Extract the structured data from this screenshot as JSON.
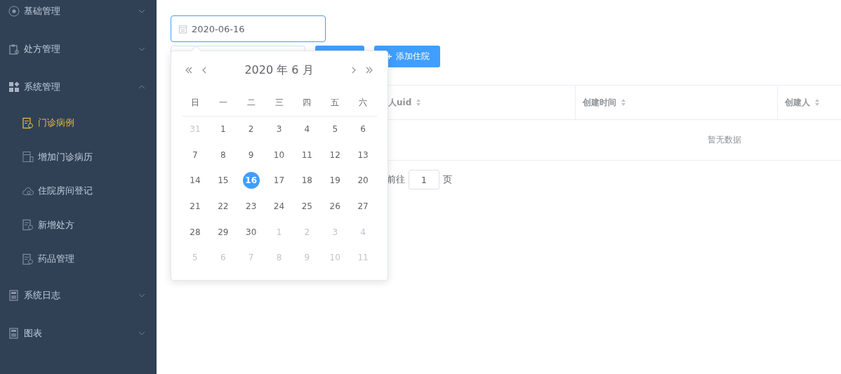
{
  "sidebar": {
    "items": [
      {
        "label": "基础管理",
        "expanded": false
      },
      {
        "label": "处方管理",
        "expanded": false
      },
      {
        "label": "系统管理",
        "expanded": true,
        "children": [
          {
            "label": "门诊病例",
            "selected": true
          },
          {
            "label": "增加门诊病历",
            "selected": false
          },
          {
            "label": "住院房间登记",
            "selected": false
          },
          {
            "label": "新增处方",
            "selected": false
          },
          {
            "label": "药品管理",
            "selected": false
          }
        ]
      },
      {
        "label": "系统日志",
        "expanded": false
      },
      {
        "label": "图表",
        "expanded": false
      }
    ]
  },
  "date_field": {
    "value": "2020-06-16"
  },
  "add_button": {
    "label": "添加住院"
  },
  "date_picker": {
    "title": "2020 年 6 月",
    "weekdays": [
      "日",
      "一",
      "二",
      "三",
      "四",
      "五",
      "六"
    ],
    "weeks": [
      [
        {
          "day": "31",
          "other_month": true,
          "selected": false
        },
        {
          "day": "1",
          "other_month": false,
          "selected": false
        },
        {
          "day": "2",
          "other_month": false,
          "selected": false
        },
        {
          "day": "3",
          "other_month": false,
          "selected": false
        },
        {
          "day": "4",
          "other_month": false,
          "selected": false
        },
        {
          "day": "5",
          "other_month": false,
          "selected": false
        },
        {
          "day": "6",
          "other_month": false,
          "selected": false
        }
      ],
      [
        {
          "day": "7",
          "other_month": false,
          "selected": false
        },
        {
          "day": "8",
          "other_month": false,
          "selected": false
        },
        {
          "day": "9",
          "other_month": false,
          "selected": false
        },
        {
          "day": "10",
          "other_month": false,
          "selected": false
        },
        {
          "day": "11",
          "other_month": false,
          "selected": false
        },
        {
          "day": "12",
          "other_month": false,
          "selected": false
        },
        {
          "day": "13",
          "other_month": false,
          "selected": false
        }
      ],
      [
        {
          "day": "14",
          "other_month": false,
          "selected": false
        },
        {
          "day": "15",
          "other_month": false,
          "selected": false
        },
        {
          "day": "16",
          "other_month": false,
          "selected": true
        },
        {
          "day": "17",
          "other_month": false,
          "selected": false
        },
        {
          "day": "18",
          "other_month": false,
          "selected": false
        },
        {
          "day": "19",
          "other_month": false,
          "selected": false
        },
        {
          "day": "20",
          "other_month": false,
          "selected": false
        }
      ],
      [
        {
          "day": "21",
          "other_month": false,
          "selected": false
        },
        {
          "day": "22",
          "other_month": false,
          "selected": false
        },
        {
          "day": "23",
          "other_month": false,
          "selected": false
        },
        {
          "day": "24",
          "other_month": false,
          "selected": false
        },
        {
          "day": "25",
          "other_month": false,
          "selected": false
        },
        {
          "day": "26",
          "other_month": false,
          "selected": false
        },
        {
          "day": "27",
          "other_month": false,
          "selected": false
        }
      ],
      [
        {
          "day": "28",
          "other_month": false,
          "selected": false
        },
        {
          "day": "29",
          "other_month": false,
          "selected": false
        },
        {
          "day": "30",
          "other_month": false,
          "selected": false
        },
        {
          "day": "1",
          "other_month": true,
          "selected": false
        },
        {
          "day": "2",
          "other_month": true,
          "selected": false
        },
        {
          "day": "3",
          "other_month": true,
          "selected": false
        },
        {
          "day": "4",
          "other_month": true,
          "selected": false
        }
      ],
      [
        {
          "day": "5",
          "other_month": true,
          "selected": false
        },
        {
          "day": "6",
          "other_month": true,
          "selected": false
        },
        {
          "day": "7",
          "other_month": true,
          "selected": false
        },
        {
          "day": "8",
          "other_month": true,
          "selected": false
        },
        {
          "day": "9",
          "other_month": true,
          "selected": false
        },
        {
          "day": "10",
          "other_month": true,
          "selected": false
        },
        {
          "day": "11",
          "other_month": true,
          "selected": false
        }
      ]
    ]
  },
  "table": {
    "columns": [
      {
        "label": "人uid"
      },
      {
        "label": "创建时间"
      },
      {
        "label": "创建人"
      }
    ],
    "empty_text": "暂无数据"
  },
  "pagination": {
    "goto_label": "前往",
    "page": "1",
    "page_suffix": "页"
  }
}
